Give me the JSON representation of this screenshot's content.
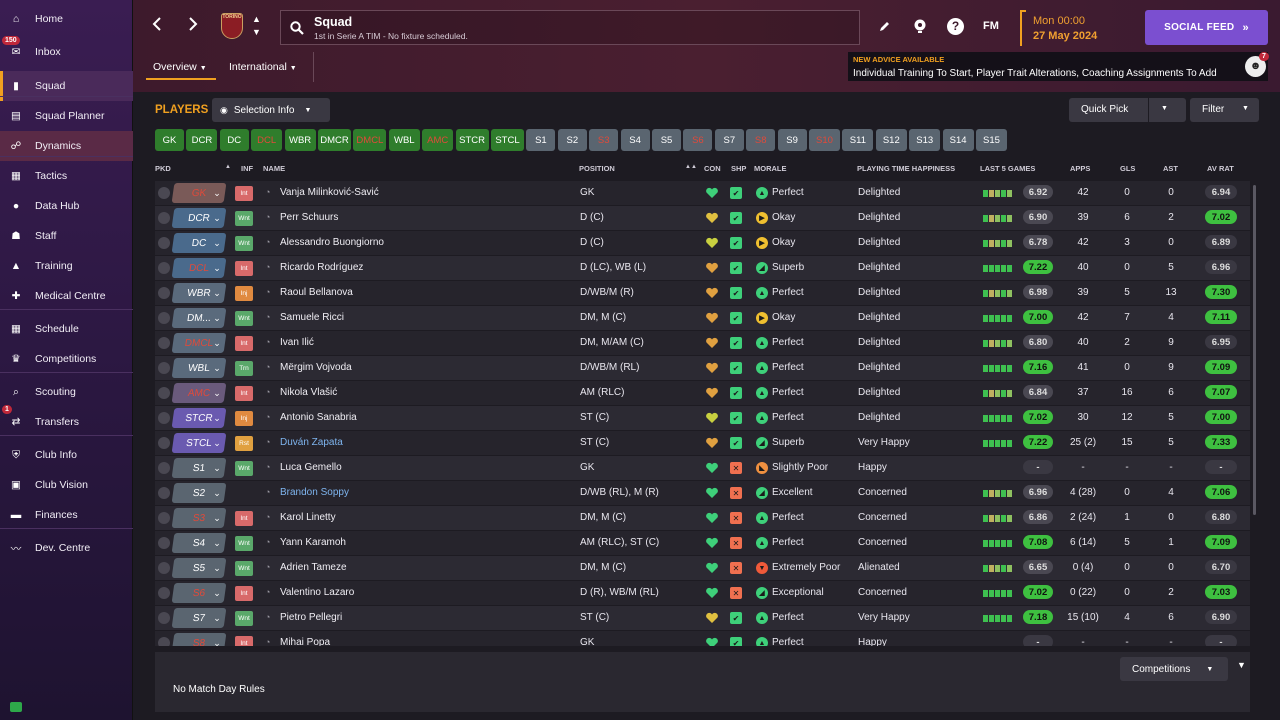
{
  "colors": {
    "accent": "#f0a020",
    "social": "#7b4fd0",
    "active_nav": "#4a2a5a"
  },
  "sidebar": {
    "items": [
      {
        "label": "Home",
        "icon": "home-icon"
      },
      {
        "label": "Inbox",
        "icon": "inbox-icon",
        "badge": "150"
      },
      {
        "label": "Squad",
        "icon": "shirt-icon"
      },
      {
        "label": "Squad Planner",
        "icon": "planner-icon"
      },
      {
        "label": "Dynamics",
        "icon": "dynamics-icon"
      },
      {
        "label": "Tactics",
        "icon": "tactics-icon"
      },
      {
        "label": "Data Hub",
        "icon": "data-hub-icon"
      },
      {
        "label": "Staff",
        "icon": "staff-icon"
      },
      {
        "label": "Training",
        "icon": "training-icon"
      },
      {
        "label": "Medical Centre",
        "icon": "medical-icon"
      },
      {
        "label": "Schedule",
        "icon": "schedule-icon"
      },
      {
        "label": "Competitions",
        "icon": "trophy-icon"
      },
      {
        "label": "Scouting",
        "icon": "scouting-icon"
      },
      {
        "label": "Transfers",
        "icon": "transfers-icon",
        "badge": "1"
      },
      {
        "label": "Club Info",
        "icon": "club-info-icon"
      },
      {
        "label": "Club Vision",
        "icon": "club-vision-icon"
      },
      {
        "label": "Finances",
        "icon": "finances-icon"
      },
      {
        "label": "Dev. Centre",
        "icon": "dev-centre-icon"
      }
    ]
  },
  "header": {
    "crest_text": "TORINO",
    "title": "Squad",
    "subtitle": "1st in Serie A TIM - No fixture scheduled.",
    "fm_label": "FM",
    "time": "Mon 00:00",
    "date": "27 May 2024",
    "social_feed": "SOCIAL FEED",
    "advice_title": "NEW ADVICE AVAILABLE",
    "advice_text": "Individual Training To Start, Player Trait Alterations, Coaching Assignments To Add",
    "advice_badge": "7",
    "tabs": [
      "Overview",
      "International"
    ]
  },
  "toolbar": {
    "players_title": "PLAYERS",
    "selection_info": "Selection Info",
    "quick_pick": "Quick Pick",
    "filter": "Filter"
  },
  "position_chips": [
    "GK",
    "DCR",
    "DC",
    "DCL",
    "WBR",
    "DMCR",
    "DMCL",
    "WBL",
    "AMC",
    "STCR",
    "STCL",
    "S1",
    "S2",
    "S3",
    "S4",
    "S5",
    "S6",
    "S7",
    "S8",
    "S9",
    "S10",
    "S11",
    "S12",
    "S13",
    "S14",
    "S15"
  ],
  "table": {
    "headers": {
      "pkd": "PKD",
      "inf": "INF",
      "name": "NAME",
      "position": "POSITION",
      "con": "CON",
      "shp": "SHP",
      "morale": "MORALE",
      "happiness": "PLAYING TIME HAPPINESS",
      "last5": "LAST 5 GAMES",
      "apps": "APPS",
      "gls": "GLS",
      "ast": "AST",
      "avrat": "AV RAT"
    },
    "rows": [
      {
        "pkd": "GK",
        "inf": "Int",
        "name": "Vanja Milinković-Savić",
        "position": "GK",
        "morale": "Perfect",
        "happiness": "Delighted",
        "form": "6.92",
        "apps": "42",
        "gls": "0",
        "ast": "0",
        "avrat": "6.94"
      },
      {
        "pkd": "DCR",
        "inf": "Wnt",
        "name": "Perr Schuurs",
        "position": "D (C)",
        "morale": "Okay",
        "happiness": "Delighted",
        "form": "6.90",
        "apps": "39",
        "gls": "6",
        "ast": "2",
        "avrat": "7.02"
      },
      {
        "pkd": "DC",
        "inf": "Wnt",
        "name": "Alessandro Buongiorno",
        "position": "D (C)",
        "morale": "Okay",
        "happiness": "Delighted",
        "form": "6.78",
        "apps": "42",
        "gls": "3",
        "ast": "0",
        "avrat": "6.89"
      },
      {
        "pkd": "DCL",
        "inf": "Int",
        "name": "Ricardo Rodríguez",
        "position": "D (LC), WB (L)",
        "morale": "Superb",
        "happiness": "Delighted",
        "form": "7.22",
        "apps": "40",
        "gls": "0",
        "ast": "5",
        "avrat": "6.96"
      },
      {
        "pkd": "WBR",
        "inf": "Inj",
        "name": "Raoul Bellanova",
        "position": "D/WB/M (R)",
        "morale": "Perfect",
        "happiness": "Delighted",
        "form": "6.98",
        "apps": "39",
        "gls": "5",
        "ast": "13",
        "avrat": "7.30"
      },
      {
        "pkd": "DM...",
        "inf": "Wnt",
        "name": "Samuele Ricci",
        "position": "DM, M (C)",
        "morale": "Okay",
        "happiness": "Delighted",
        "form": "7.00",
        "apps": "42",
        "gls": "7",
        "ast": "4",
        "avrat": "7.11"
      },
      {
        "pkd": "DMCL",
        "inf": "Int",
        "name": "Ivan Ilić",
        "position": "DM, M/AM (C)",
        "morale": "Perfect",
        "happiness": "Delighted",
        "form": "6.80",
        "apps": "40",
        "gls": "2",
        "ast": "9",
        "avrat": "6.95"
      },
      {
        "pkd": "WBL",
        "inf": "Trn",
        "name": "Mërgim Vojvoda",
        "position": "D/WB/M (RL)",
        "morale": "Perfect",
        "happiness": "Delighted",
        "form": "7.16",
        "apps": "41",
        "gls": "0",
        "ast": "9",
        "avrat": "7.09"
      },
      {
        "pkd": "AMC",
        "inf": "Int",
        "name": "Nikola Vlašić",
        "position": "AM (RLC)",
        "morale": "Perfect",
        "happiness": "Delighted",
        "form": "6.84",
        "apps": "37",
        "gls": "16",
        "ast": "6",
        "avrat": "7.07"
      },
      {
        "pkd": "STCR",
        "inf": "Inj",
        "name": "Antonio Sanabria",
        "position": "ST (C)",
        "morale": "Perfect",
        "happiness": "Delighted",
        "form": "7.02",
        "apps": "30",
        "gls": "12",
        "ast": "5",
        "avrat": "7.00"
      },
      {
        "pkd": "STCL",
        "inf": "Rst",
        "name": "Duván Zapata",
        "position": "ST (C)",
        "morale": "Superb",
        "happiness": "Very Happy",
        "form": "7.22",
        "apps": "25 (2)",
        "gls": "15",
        "ast": "5",
        "avrat": "7.33"
      },
      {
        "pkd": "S1",
        "inf": "Wnt",
        "name": "Luca Gemello",
        "position": "GK",
        "morale": "Slightly Poor",
        "happiness": "Happy",
        "form": "-",
        "apps": "-",
        "gls": "-",
        "ast": "-",
        "avrat": "-"
      },
      {
        "pkd": "S2",
        "inf": "",
        "name": "Brandon Soppy",
        "position": "D/WB (RL), M (R)",
        "morale": "Excellent",
        "happiness": "Concerned",
        "form": "6.96",
        "apps": "4 (28)",
        "gls": "0",
        "ast": "4",
        "avrat": "7.06"
      },
      {
        "pkd": "S3",
        "inf": "Int",
        "name": "Karol Linetty",
        "position": "DM, M (C)",
        "morale": "Perfect",
        "happiness": "Concerned",
        "form": "6.86",
        "apps": "2 (24)",
        "gls": "1",
        "ast": "0",
        "avrat": "6.80"
      },
      {
        "pkd": "S4",
        "inf": "Wnt",
        "name": "Yann Karamoh",
        "position": "AM (RLC), ST (C)",
        "morale": "Perfect",
        "happiness": "Concerned",
        "form": "7.08",
        "apps": "6 (14)",
        "gls": "5",
        "ast": "1",
        "avrat": "7.09"
      },
      {
        "pkd": "S5",
        "inf": "Wnt",
        "name": "Adrien Tameze",
        "position": "DM, M (C)",
        "morale": "Extremely Poor",
        "happiness": "Alienated",
        "form": "6.65",
        "apps": "0 (4)",
        "gls": "0",
        "ast": "0",
        "avrat": "6.70"
      },
      {
        "pkd": "S6",
        "inf": "Int",
        "name": "Valentino Lazaro",
        "position": "D (R), WB/M (RL)",
        "morale": "Exceptional",
        "happiness": "Concerned",
        "form": "7.02",
        "apps": "0 (22)",
        "gls": "0",
        "ast": "2",
        "avrat": "7.03"
      },
      {
        "pkd": "S7",
        "inf": "Wnt",
        "name": "Pietro Pellegri",
        "position": "ST (C)",
        "morale": "Perfect",
        "happiness": "Very Happy",
        "form": "7.18",
        "apps": "15 (10)",
        "gls": "4",
        "ast": "6",
        "avrat": "6.90"
      },
      {
        "pkd": "S8",
        "inf": "Int",
        "name": "Mihai Popa",
        "position": "GK",
        "morale": "Perfect",
        "happiness": "Happy",
        "form": "-",
        "apps": "-",
        "gls": "-",
        "ast": "-",
        "avrat": "-"
      }
    ]
  },
  "footer": {
    "no_rules": "No Match Day Rules",
    "competitions": "Competitions"
  }
}
